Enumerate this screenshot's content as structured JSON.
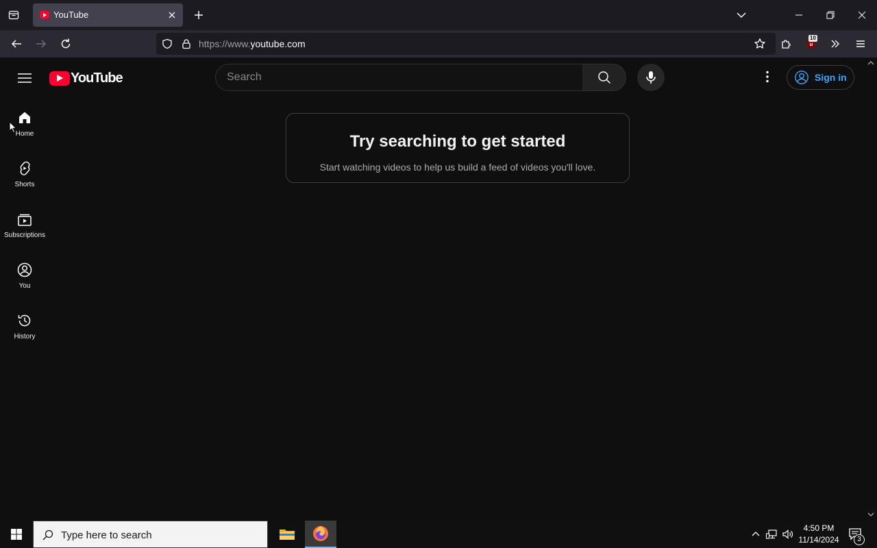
{
  "browser": {
    "tab": {
      "title": "YouTube"
    },
    "url": {
      "prefix": "https://www.",
      "domain": "youtube.com"
    },
    "extension_badge": "10"
  },
  "youtube": {
    "logo_text": "YouTube",
    "search": {
      "placeholder": "Search"
    },
    "sign_in_label": "Sign in",
    "guide": [
      {
        "label": "Home",
        "icon": "home-icon"
      },
      {
        "label": "Shorts",
        "icon": "shorts-icon"
      },
      {
        "label": "Subscriptions",
        "icon": "subscriptions-icon"
      },
      {
        "label": "You",
        "icon": "you-icon"
      },
      {
        "label": "History",
        "icon": "history-icon"
      }
    ],
    "empty_state": {
      "title": "Try searching to get started",
      "subtitle": "Start watching videos to help us build a feed of videos you'll love."
    }
  },
  "taskbar": {
    "search_placeholder": "Type here to search",
    "time": "4:50 PM",
    "date": "11/14/2024",
    "notification_count": "3"
  },
  "colors": {
    "yt_red": "#ff0033",
    "link_blue": "#3ea6ff",
    "background": "#0f0f0f"
  }
}
